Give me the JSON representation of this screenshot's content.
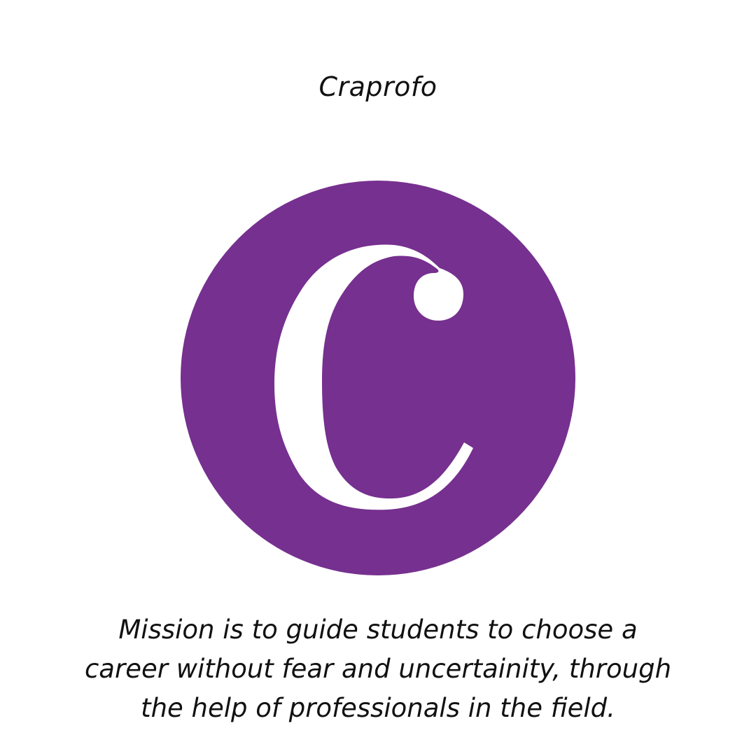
{
  "brand": {
    "name": "Craprofo"
  },
  "logo": {
    "letter": "C",
    "circle_color": "#76308f",
    "letter_color": "#ffffff"
  },
  "mission": {
    "lines": [
      "Mission is to guide students to choose a",
      "career without fear and uncertainity, through",
      "the help of professionals in the field."
    ]
  }
}
